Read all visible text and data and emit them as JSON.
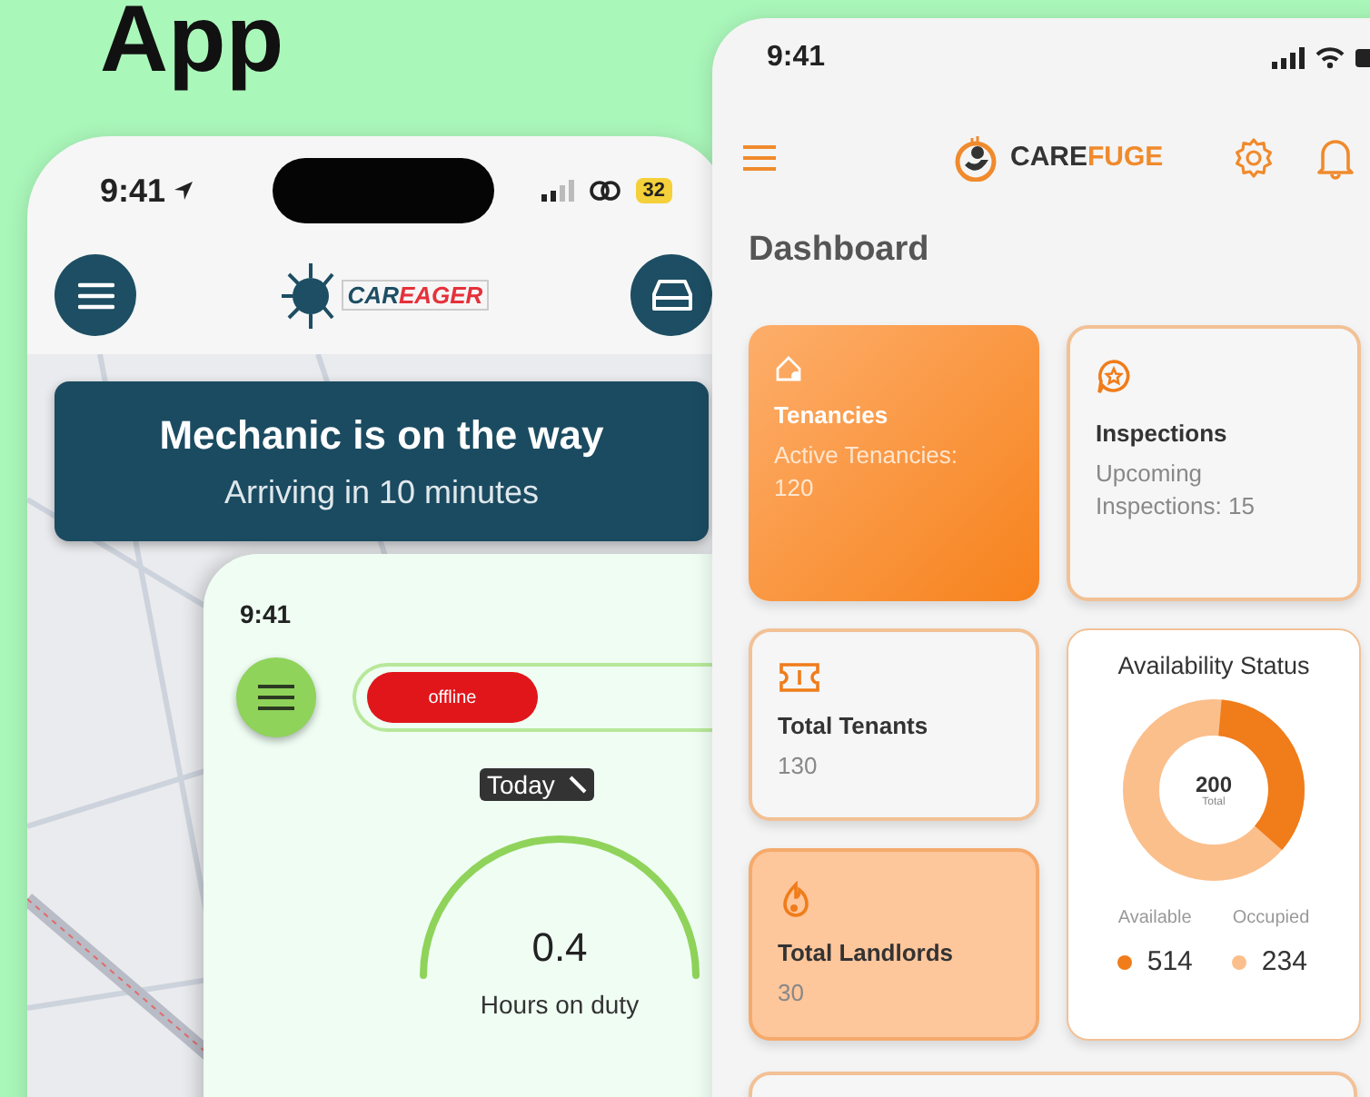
{
  "heading": "App",
  "rider_app": {
    "status_time": "9:41",
    "battery": "32",
    "logo": {
      "parts": [
        "CAR",
        "EAGER"
      ]
    },
    "banner": {
      "title": "Mechanic is on the way",
      "subtitle": "Arriving in 10 minutes"
    }
  },
  "driver_app": {
    "status_time": "9:41",
    "duty_toggle": {
      "label": "offline",
      "on": false
    },
    "period": "Today",
    "gauge": {
      "value": "0.4",
      "label": "Hours on duty"
    }
  },
  "dashboard_app": {
    "status_time": "9:41",
    "brand": {
      "parts": [
        "CARE",
        "FUGE"
      ]
    },
    "title": "Dashboard",
    "cards": [
      {
        "kind": "highlight",
        "title": "Tenancies",
        "detail": "Active Tenancies: 120"
      },
      {
        "kind": "plain",
        "title": "Inspections",
        "detail": "Upcoming Inspections: 15"
      },
      {
        "kind": "plain",
        "title": "Total Tenants",
        "detail": "130"
      },
      {
        "kind": "availability",
        "title": "Availability Status",
        "center_value": "200",
        "center_label": "Total",
        "legend": [
          {
            "label": "Available",
            "value": "514",
            "color": "#f07c1a"
          },
          {
            "label": "Occupied",
            "value": "234",
            "color": "#fbbf8c"
          }
        ]
      },
      {
        "kind": "tinted",
        "title": "Total Landlords",
        "detail": "30"
      }
    ]
  }
}
